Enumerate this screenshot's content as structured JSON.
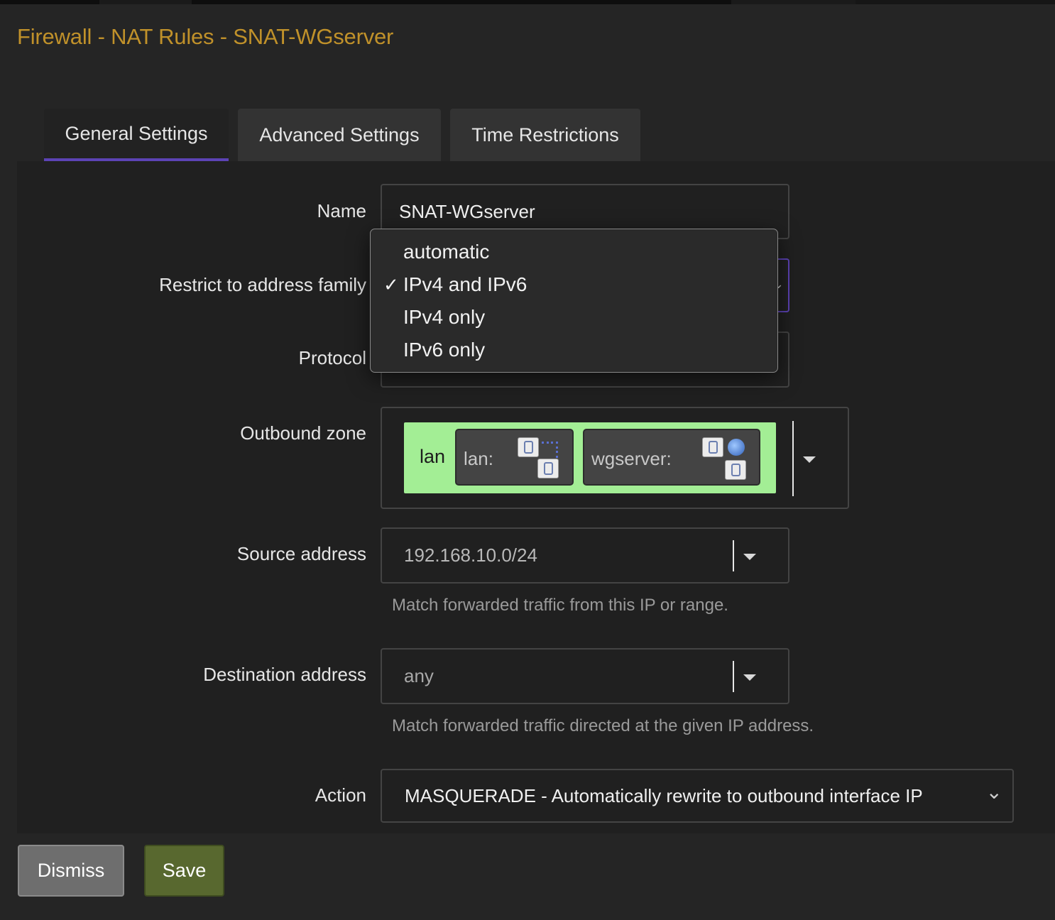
{
  "page": {
    "title": "Firewall - NAT Rules - SNAT-WGserver"
  },
  "tabs": [
    {
      "label": "General Settings",
      "active": true
    },
    {
      "label": "Advanced Settings",
      "active": false
    },
    {
      "label": "Time Restrictions",
      "active": false
    }
  ],
  "form": {
    "name": {
      "label": "Name",
      "value": "SNAT-WGserver"
    },
    "family": {
      "label": "Restrict to address family",
      "options": [
        "automatic",
        "IPv4 and IPv6",
        "IPv4 only",
        "IPv6 only"
      ],
      "selected": "IPv4 and IPv6",
      "check_mark": "✓"
    },
    "protocol": {
      "label": "Protocol"
    },
    "outbound_zone": {
      "label": "Outbound zone",
      "zone_name": "lan",
      "zone_color": "#a3ee95",
      "interfaces": [
        {
          "label": "lan:",
          "icons": [
            "network-port-icon",
            "bridge-dotted-icon",
            "network-port-icon"
          ]
        },
        {
          "label": "wgserver:",
          "icons": [
            "network-port-icon",
            "globe-icon",
            "network-port-icon"
          ]
        }
      ]
    },
    "source_address": {
      "label": "Source address",
      "value": "192.168.10.0/24",
      "hint": "Match forwarded traffic from this IP or range."
    },
    "destination_address": {
      "label": "Destination address",
      "value": "any",
      "hint": "Match forwarded traffic directed at the given IP address."
    },
    "action": {
      "label": "Action",
      "value": "MASQUERADE - Automatically rewrite to outbound interface IP"
    }
  },
  "buttons": {
    "dismiss": "Dismiss",
    "save": "Save"
  },
  "colors": {
    "title": "#c0912a",
    "tab_active_underline": "#5c43b5",
    "dismiss_bg": "#6e6e6e",
    "save_bg": "#58682f"
  }
}
